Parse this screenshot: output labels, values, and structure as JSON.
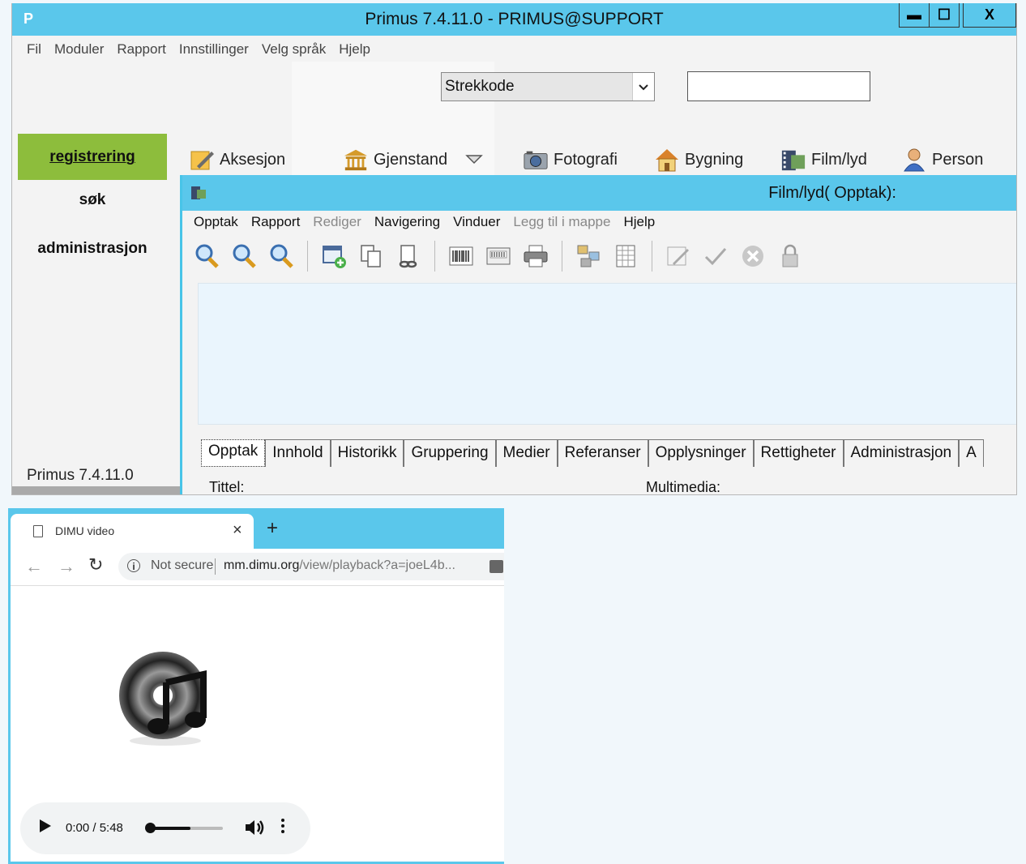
{
  "primus": {
    "title": "Primus 7.4.11.0 - PRIMUS@SUPPORT",
    "logo": "P",
    "window_buttons": {
      "minimize": "▬",
      "maximize": "☐",
      "close": "X"
    },
    "menu": [
      "Fil",
      "Moduler",
      "Rapport",
      "Innstillinger",
      "Velg språk",
      "Hjelp"
    ],
    "search_type": "Strekkode",
    "search_value": "",
    "nav": {
      "registrering": "registrering",
      "sok": "søk",
      "administrasjon": "administrasjon"
    },
    "version": "Primus 7.4.11.0",
    "modules": [
      "Aksesjon",
      "Gjenstand",
      "Fotografi",
      "Bygning",
      "Film/lyd",
      "Person"
    ]
  },
  "subwindow": {
    "title": "Film/lyd( Opptak):",
    "menu": [
      "Opptak",
      "Rapport",
      "Rediger",
      "Navigering",
      "Vinduer",
      "Legg til i mappe",
      "Hjelp"
    ],
    "disabled_menu": [
      "Rediger",
      "Legg til i mappe"
    ],
    "toolbar_icons": [
      "search-s-icon",
      "search-icon",
      "search-m-icon",
      "new-record-icon",
      "copy-record-icon",
      "link-icon",
      "barcode-icon",
      "barcode-card-icon",
      "print-icon",
      "tree-icon",
      "grid-icon",
      "edit-icon",
      "check-icon",
      "cancel-icon",
      "lock-icon"
    ],
    "tabs": [
      "Opptak",
      "Innhold",
      "Historikk",
      "Gruppering",
      "Medier",
      "Referanser",
      "Opplysninger",
      "Rettigheter",
      "Administrasjon",
      "A"
    ],
    "active_tab": "Opptak",
    "fields": {
      "tittel": "Tittel:",
      "multimedia": "Multimedia:"
    }
  },
  "browser": {
    "tab_title": "DIMU video",
    "tab_close": "×",
    "new_tab": "+",
    "not_secure": "Not secure",
    "url_host": "mm.dimu.org",
    "url_path": "/view/playback?a=joeL4b...",
    "player": {
      "time": "0:00 / 5:48",
      "progress_fraction": 0.55
    }
  },
  "colors": {
    "accent": "#5ac7eb",
    "nav_active": "#8dbd3c",
    "content_bg": "#eaf5fd"
  }
}
